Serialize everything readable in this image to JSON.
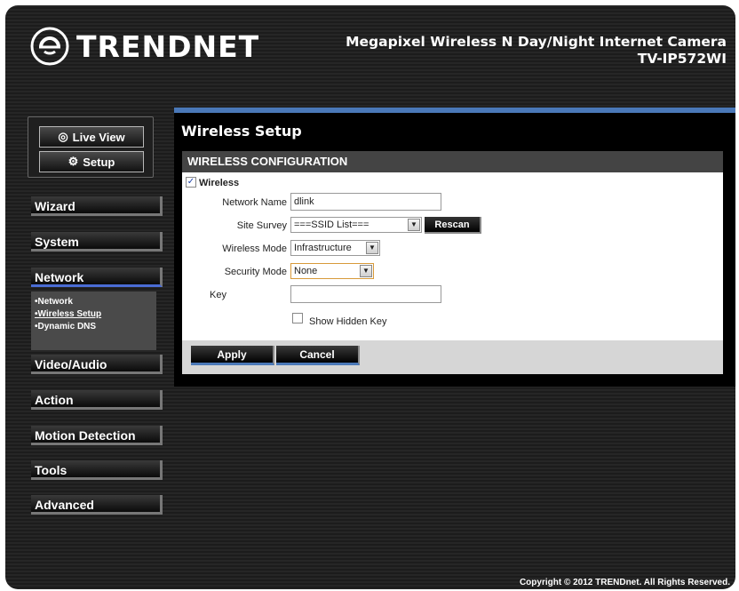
{
  "header": {
    "brand": "TRENDNET",
    "product_line": "Megapixel Wireless N Day/Night Internet Camera",
    "model": "TV-IP572WI"
  },
  "view_buttons": {
    "live_view": "Live View",
    "setup": "Setup"
  },
  "nav": {
    "items": [
      {
        "label": "Wizard"
      },
      {
        "label": "System"
      },
      {
        "label": "Network"
      },
      {
        "label": "Video/Audio"
      },
      {
        "label": "Action"
      },
      {
        "label": "Motion Detection"
      },
      {
        "label": "Tools"
      },
      {
        "label": "Advanced"
      }
    ],
    "sub_items": [
      "•Network",
      "•Wireless Setup",
      "•Dynamic DNS"
    ]
  },
  "page": {
    "title": "Wireless Setup",
    "section": "WIRELESS CONFIGURATION"
  },
  "form": {
    "wireless_label": "Wireless",
    "network_name_label": "Network Name",
    "network_name_value": "dlink",
    "site_survey_label": "Site Survey",
    "site_survey_value": "===SSID List===",
    "rescan_label": "Rescan",
    "wireless_mode_label": "Wireless Mode",
    "wireless_mode_value": "Infrastructure",
    "security_mode_label": "Security Mode",
    "security_mode_value": "None",
    "key_label": "Key",
    "key_value": "",
    "show_hidden_key_label": "Show Hidden Key"
  },
  "actions": {
    "apply": "Apply",
    "cancel": "Cancel"
  },
  "footer": {
    "copyright": "Copyright © 2012 TRENDnet. All Rights Reserved."
  },
  "colors": {
    "accent_blue": "#4a78b8"
  }
}
